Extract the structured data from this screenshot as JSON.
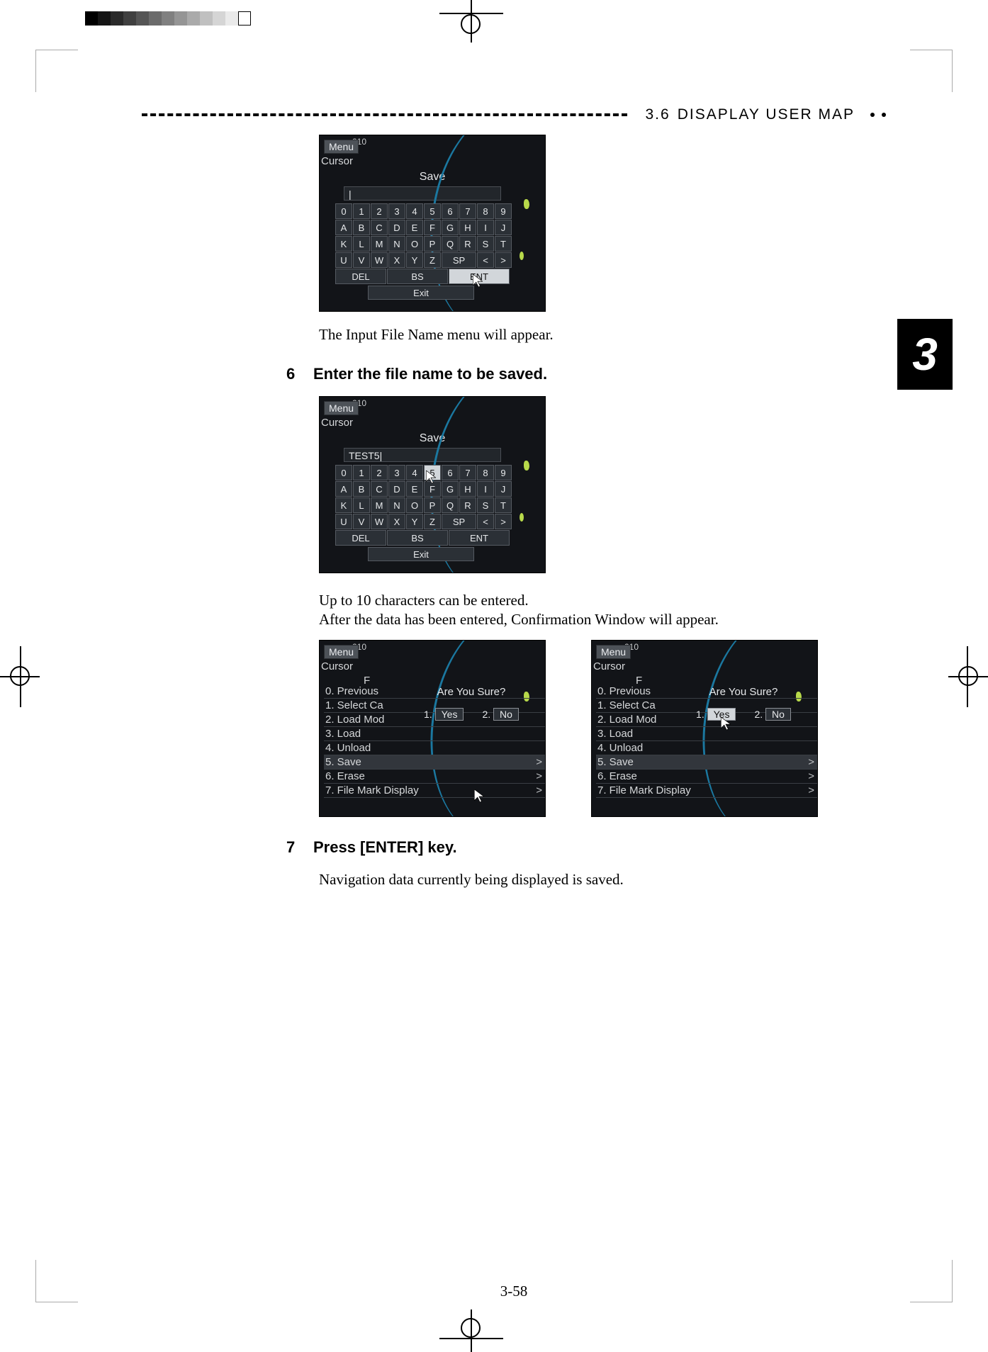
{
  "header": {
    "section": "3.6",
    "title": "DISAPLAY USER MAP"
  },
  "sideTab": "3",
  "captions": {
    "afterMenu": "The Input File Name menu will appear.",
    "upto": "Up to 10 characters can be entered.",
    "afterEntered": "After the data has been entered, Confirmation Window will appear.",
    "navSaved": "Navigation data currently being displayed is saved."
  },
  "steps": {
    "s6": {
      "num": "6",
      "text": "Enter the file name to be saved."
    },
    "s7": {
      "num": "7",
      "text": "Press [ENTER] key."
    }
  },
  "device": {
    "menu": "Menu",
    "cursor": "Cursor",
    "save": "Save",
    "inputEmpty": "|",
    "inputTest": "TEST5|",
    "row1": [
      "0",
      "1",
      "2",
      "3",
      "4",
      "5",
      "6",
      "7",
      "8",
      "9"
    ],
    "row2": [
      "A",
      "B",
      "C",
      "D",
      "E",
      "F",
      "G",
      "H",
      "I",
      "J"
    ],
    "row3": [
      "K",
      "L",
      "M",
      "N",
      "O",
      "P",
      "Q",
      "R",
      "S",
      "T"
    ],
    "row4": [
      "U",
      "V",
      "W",
      "X",
      "Y",
      "Z",
      "SP",
      "<",
      ">"
    ],
    "del": "DEL",
    "bs": "BS",
    "ent": "ENT",
    "exit": "Exit",
    "scale": "210"
  },
  "fileMenu": {
    "f": "F",
    "items": [
      "0. Previous",
      "1. Select Ca",
      "2. Load Mod",
      "3. Load",
      "4. Unload",
      "5. Save",
      "6. Erase",
      "7. File Mark Display"
    ]
  },
  "confirm": {
    "q": "Are You Sure?",
    "yesNum": "1.",
    "yes": "Yes",
    "noNum": "2.",
    "no": "No"
  },
  "pageNumber": "3-58"
}
